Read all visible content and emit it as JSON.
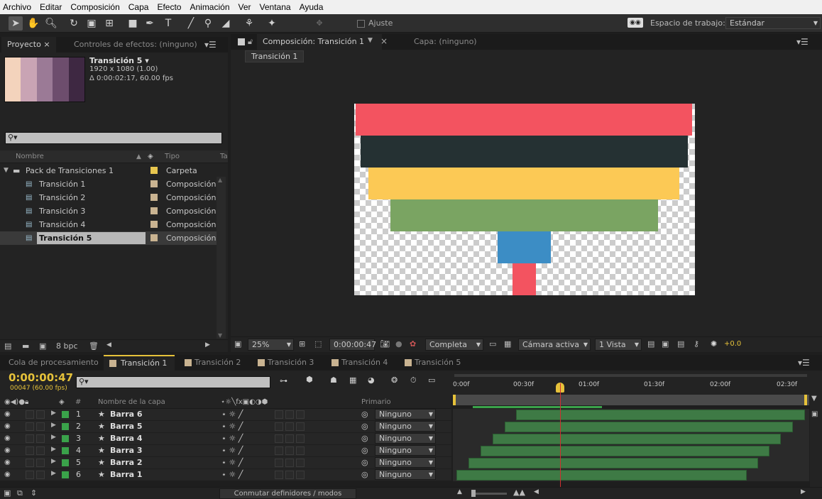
{
  "menu": [
    "Archivo",
    "Editar",
    "Composición",
    "Capa",
    "Efecto",
    "Animación",
    "Ver",
    "Ventana",
    "Ayuda"
  ],
  "toolbar": {
    "snap_label": "Ajuste",
    "workspace_label": "Espacio de trabajo:",
    "workspace_value": "Estándar"
  },
  "project": {
    "tab_project": "Proyecto",
    "tab_effects": "Controles de efectos: (ninguno)",
    "item_name": "Transición 5 ▾",
    "item_size": "1920 x 1080 (1.00)",
    "item_duration": "Δ 0:00:02:17, 60.00 fps",
    "search_placeholder": "",
    "col_name": "Nombre",
    "col_type": "Tipo",
    "col_extra": "Ta",
    "folder": {
      "name": "Pack de Transiciones 1",
      "type": "Carpeta"
    },
    "items": [
      {
        "name": "Transición 1",
        "type": "Composición"
      },
      {
        "name": "Transición 2",
        "type": "Composición"
      },
      {
        "name": "Transición 3",
        "type": "Composición"
      },
      {
        "name": "Transición 4",
        "type": "Composición"
      },
      {
        "name": "Transición 5",
        "type": "Composición"
      }
    ],
    "bpc": "8 bpc",
    "thumb_colors": [
      "#f3d3bc",
      "#c9a4b4",
      "#9b7a96",
      "#6d4d6d",
      "#3e2842"
    ]
  },
  "comp": {
    "tab_title": "Composición: Transición 1",
    "layer_tab": "Capa: (ninguno)",
    "sub_tab": "Transición 1",
    "zoom": "25%",
    "timecode": "0:00:00:47",
    "resolution": "Completa",
    "camera": "Cámara activa",
    "views": "1 Vista",
    "exposure": "+0.0",
    "bars": [
      {
        "color": "#f35360"
      },
      {
        "color": "#253133"
      },
      {
        "color": "#fcc955"
      },
      {
        "color": "#7aa462"
      },
      {
        "color": "#3c8dc5"
      },
      {
        "color": "#f35360"
      }
    ]
  },
  "timeline": {
    "tabs": [
      "Cola de procesamiento",
      "Transición 1",
      "Transición 2",
      "Transición 3",
      "Transición 4",
      "Transición 5"
    ],
    "timecode": "0:00:00:47",
    "frames": "00047 (60.00 fps)",
    "col_num": "#",
    "col_layer": "Nombre de la capa",
    "col_parent": "Primario",
    "ruler": [
      "0:00f",
      "00:30f",
      "01:00f",
      "01:30f",
      "02:00f",
      "02:30f"
    ],
    "layers": [
      {
        "num": "1",
        "name": "Barra 6",
        "parent": "Ninguno"
      },
      {
        "num": "2",
        "name": "Barra 5",
        "parent": "Ninguno"
      },
      {
        "num": "3",
        "name": "Barra 4",
        "parent": "Ninguno"
      },
      {
        "num": "4",
        "name": "Barra 3",
        "parent": "Ninguno"
      },
      {
        "num": "5",
        "name": "Barra 2",
        "parent": "Ninguno"
      },
      {
        "num": "6",
        "name": "Barra 1",
        "parent": "Ninguno"
      }
    ],
    "footer_button": "Conmutar definidores / modos"
  }
}
